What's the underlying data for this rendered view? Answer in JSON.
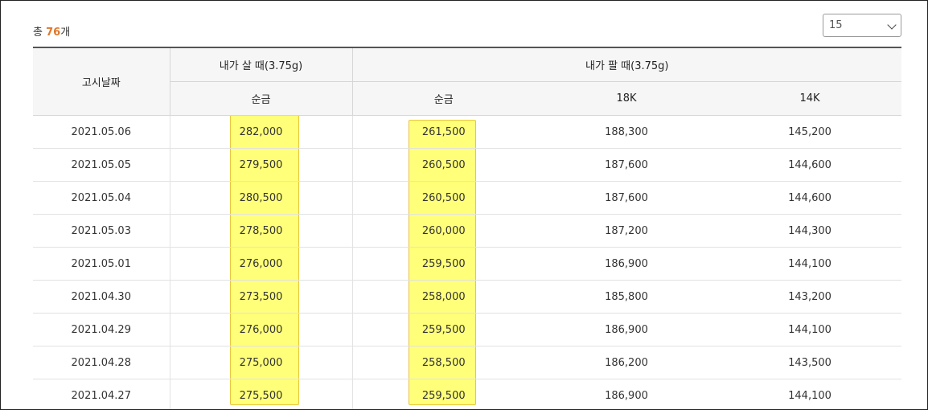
{
  "summary": {
    "prefix": "총 ",
    "count": "76",
    "suffix": "개"
  },
  "page_size": {
    "value": "15"
  },
  "header": {
    "date": "고시날짜",
    "buy_group": "내가 살 때(3.75g)",
    "sell_group": "내가 팔 때(3.75g)",
    "buy_pure": "순금",
    "sell_pure": "순금",
    "sell_18k": "18K",
    "sell_14k": "14K"
  },
  "rows": [
    {
      "date": "2021.05.06",
      "buy_pure": "282,000",
      "sell_pure": "261,500",
      "sell_18k": "188,300",
      "sell_14k": "145,200"
    },
    {
      "date": "2021.05.05",
      "buy_pure": "279,500",
      "sell_pure": "260,500",
      "sell_18k": "187,600",
      "sell_14k": "144,600"
    },
    {
      "date": "2021.05.04",
      "buy_pure": "280,500",
      "sell_pure": "260,500",
      "sell_18k": "187,600",
      "sell_14k": "144,600"
    },
    {
      "date": "2021.05.03",
      "buy_pure": "278,500",
      "sell_pure": "260,000",
      "sell_18k": "187,200",
      "sell_14k": "144,300"
    },
    {
      "date": "2021.05.01",
      "buy_pure": "276,000",
      "sell_pure": "259,500",
      "sell_18k": "186,900",
      "sell_14k": "144,100"
    },
    {
      "date": "2021.04.30",
      "buy_pure": "273,500",
      "sell_pure": "258,000",
      "sell_18k": "185,800",
      "sell_14k": "143,200"
    },
    {
      "date": "2021.04.29",
      "buy_pure": "276,000",
      "sell_pure": "259,500",
      "sell_18k": "186,900",
      "sell_14k": "144,100"
    },
    {
      "date": "2021.04.28",
      "buy_pure": "275,000",
      "sell_pure": "258,500",
      "sell_18k": "186,200",
      "sell_14k": "143,500"
    },
    {
      "date": "2021.04.27",
      "buy_pure": "275,500",
      "sell_pure": "259,500",
      "sell_18k": "186,900",
      "sell_14k": "144,100"
    }
  ],
  "colors": {
    "count_accent": "#e0762b",
    "highlight_fill": "#ffff7a",
    "highlight_border": "#e8c640"
  }
}
